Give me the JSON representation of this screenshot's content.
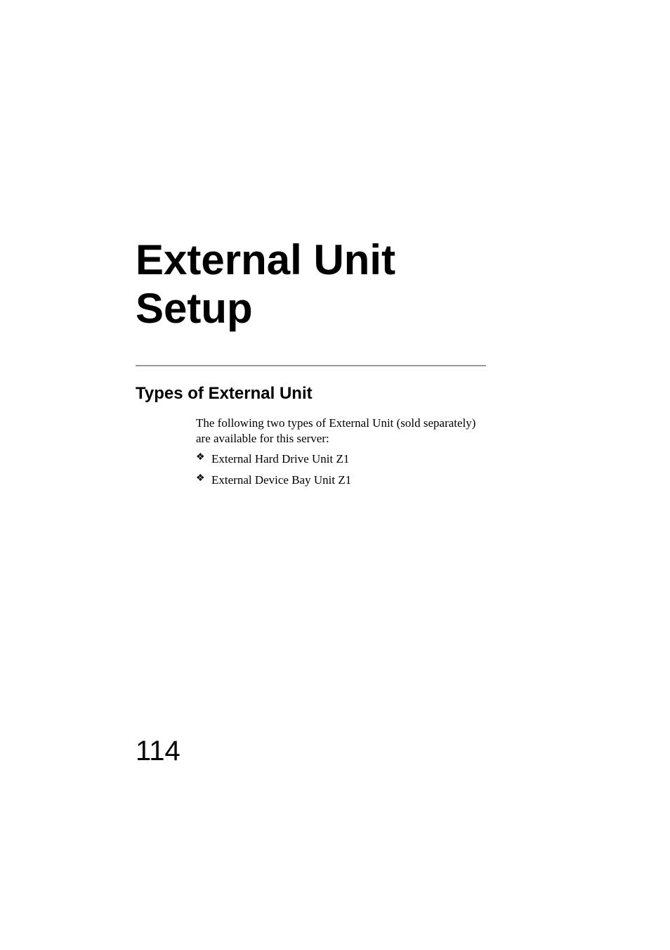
{
  "chapter": {
    "title_line1": "External Unit",
    "title_line2": "Setup"
  },
  "section": {
    "heading": "Types of External Unit",
    "intro": "The following two types of External Unit (sold separately) are available for this server:",
    "bullets": [
      "External Hard Drive Unit Z1",
      "External Device Bay Unit Z1"
    ]
  },
  "page_number": "114",
  "bullet_glyph": "❖"
}
